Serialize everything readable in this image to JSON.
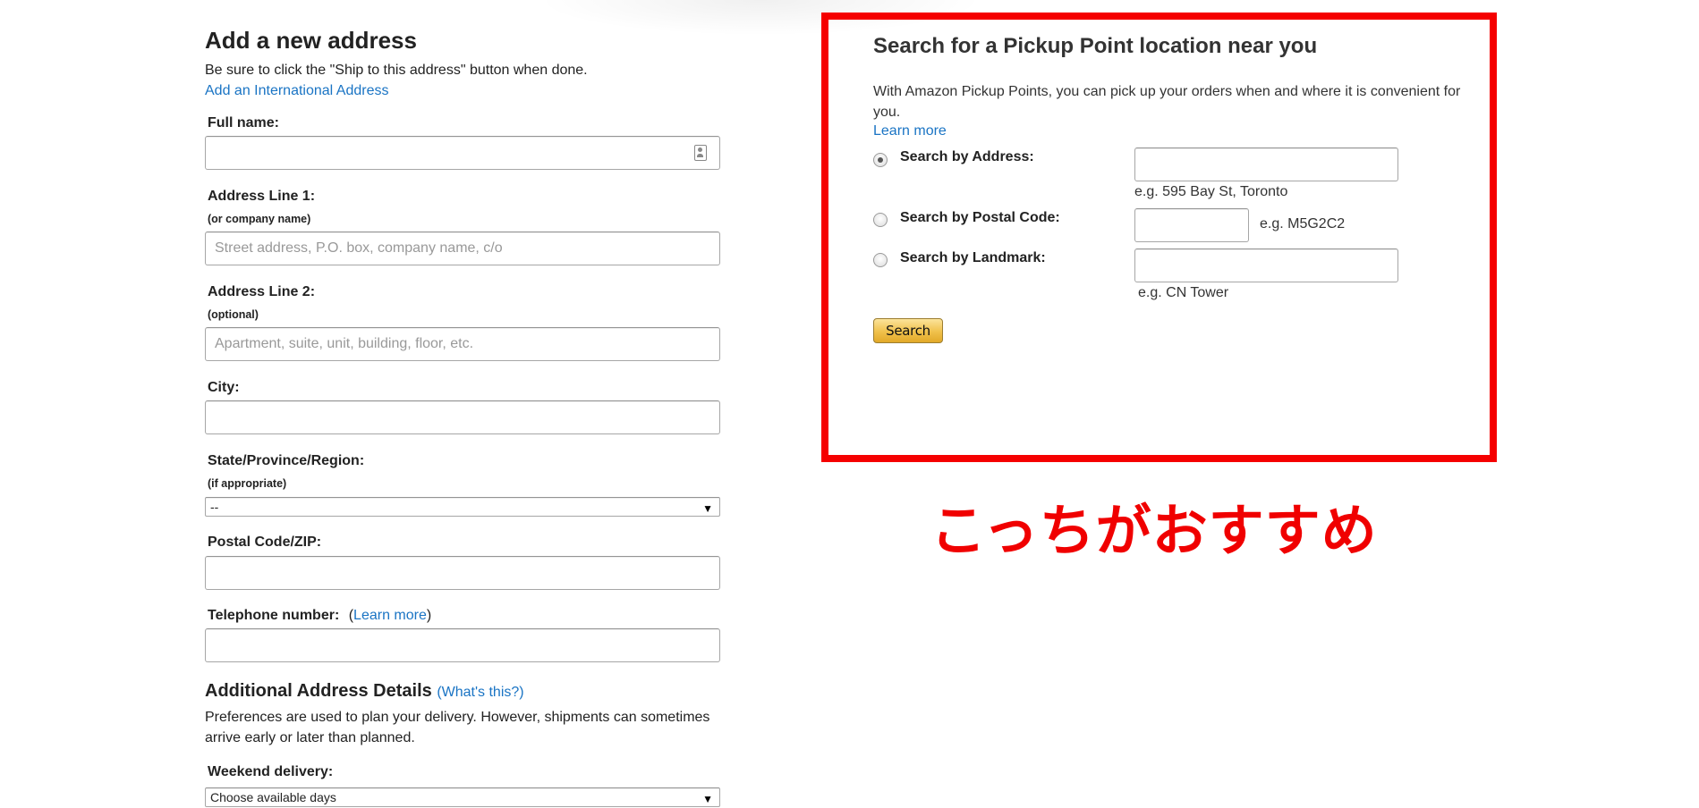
{
  "address_form": {
    "title": "Add a new address",
    "instructions": "Be sure to click the \"Ship to this address\" button when done.",
    "international_link": "Add an International Address",
    "full_name": {
      "label": "Full name:",
      "value": "",
      "icon": "contact-card-icon"
    },
    "address_line_1": {
      "label": "Address Line 1:",
      "sublabel": "(or company name)",
      "placeholder": "Street address, P.O. box, company name, c/o"
    },
    "address_line_2": {
      "label": "Address Line 2:",
      "sublabel": "(optional)",
      "placeholder": "Apartment, suite, unit, building, floor, etc."
    },
    "city": {
      "label": "City:",
      "value": ""
    },
    "state": {
      "label": "State/Province/Region:",
      "sublabel": "(if appropriate)",
      "selected": "--"
    },
    "postal_code": {
      "label": "Postal Code/ZIP:",
      "value": ""
    },
    "telephone": {
      "label": "Telephone number:",
      "open_paren": "(",
      "learn_more": "Learn more",
      "close_paren": ")"
    },
    "additional": {
      "title": "Additional Address Details",
      "whats_this": "(What's this?)",
      "description": "Preferences are used to plan your delivery. However, shipments can sometimes arrive early or later than planned."
    },
    "weekend_delivery": {
      "label": "Weekend delivery:",
      "selected": "Choose available days"
    }
  },
  "pickup": {
    "title": "Search for a Pickup Point location near you",
    "description": "With Amazon Pickup Points, you can pick up your orders when and where it is convenient for you.",
    "learn_more": "Learn more",
    "options": [
      {
        "label": "Search by Address:",
        "hint": "e.g. 595 Bay St, Toronto",
        "selected": true
      },
      {
        "label": "Search by Postal Code:",
        "hint": "e.g. M5G2C2",
        "selected": false
      },
      {
        "label": "Search by Landmark:",
        "hint": "e.g. CN Tower",
        "selected": false
      }
    ],
    "search_button": "Search",
    "highlight_color": "#f50000"
  },
  "annotation": {
    "text": "こっちがおすすめ",
    "color": "#f00000"
  }
}
